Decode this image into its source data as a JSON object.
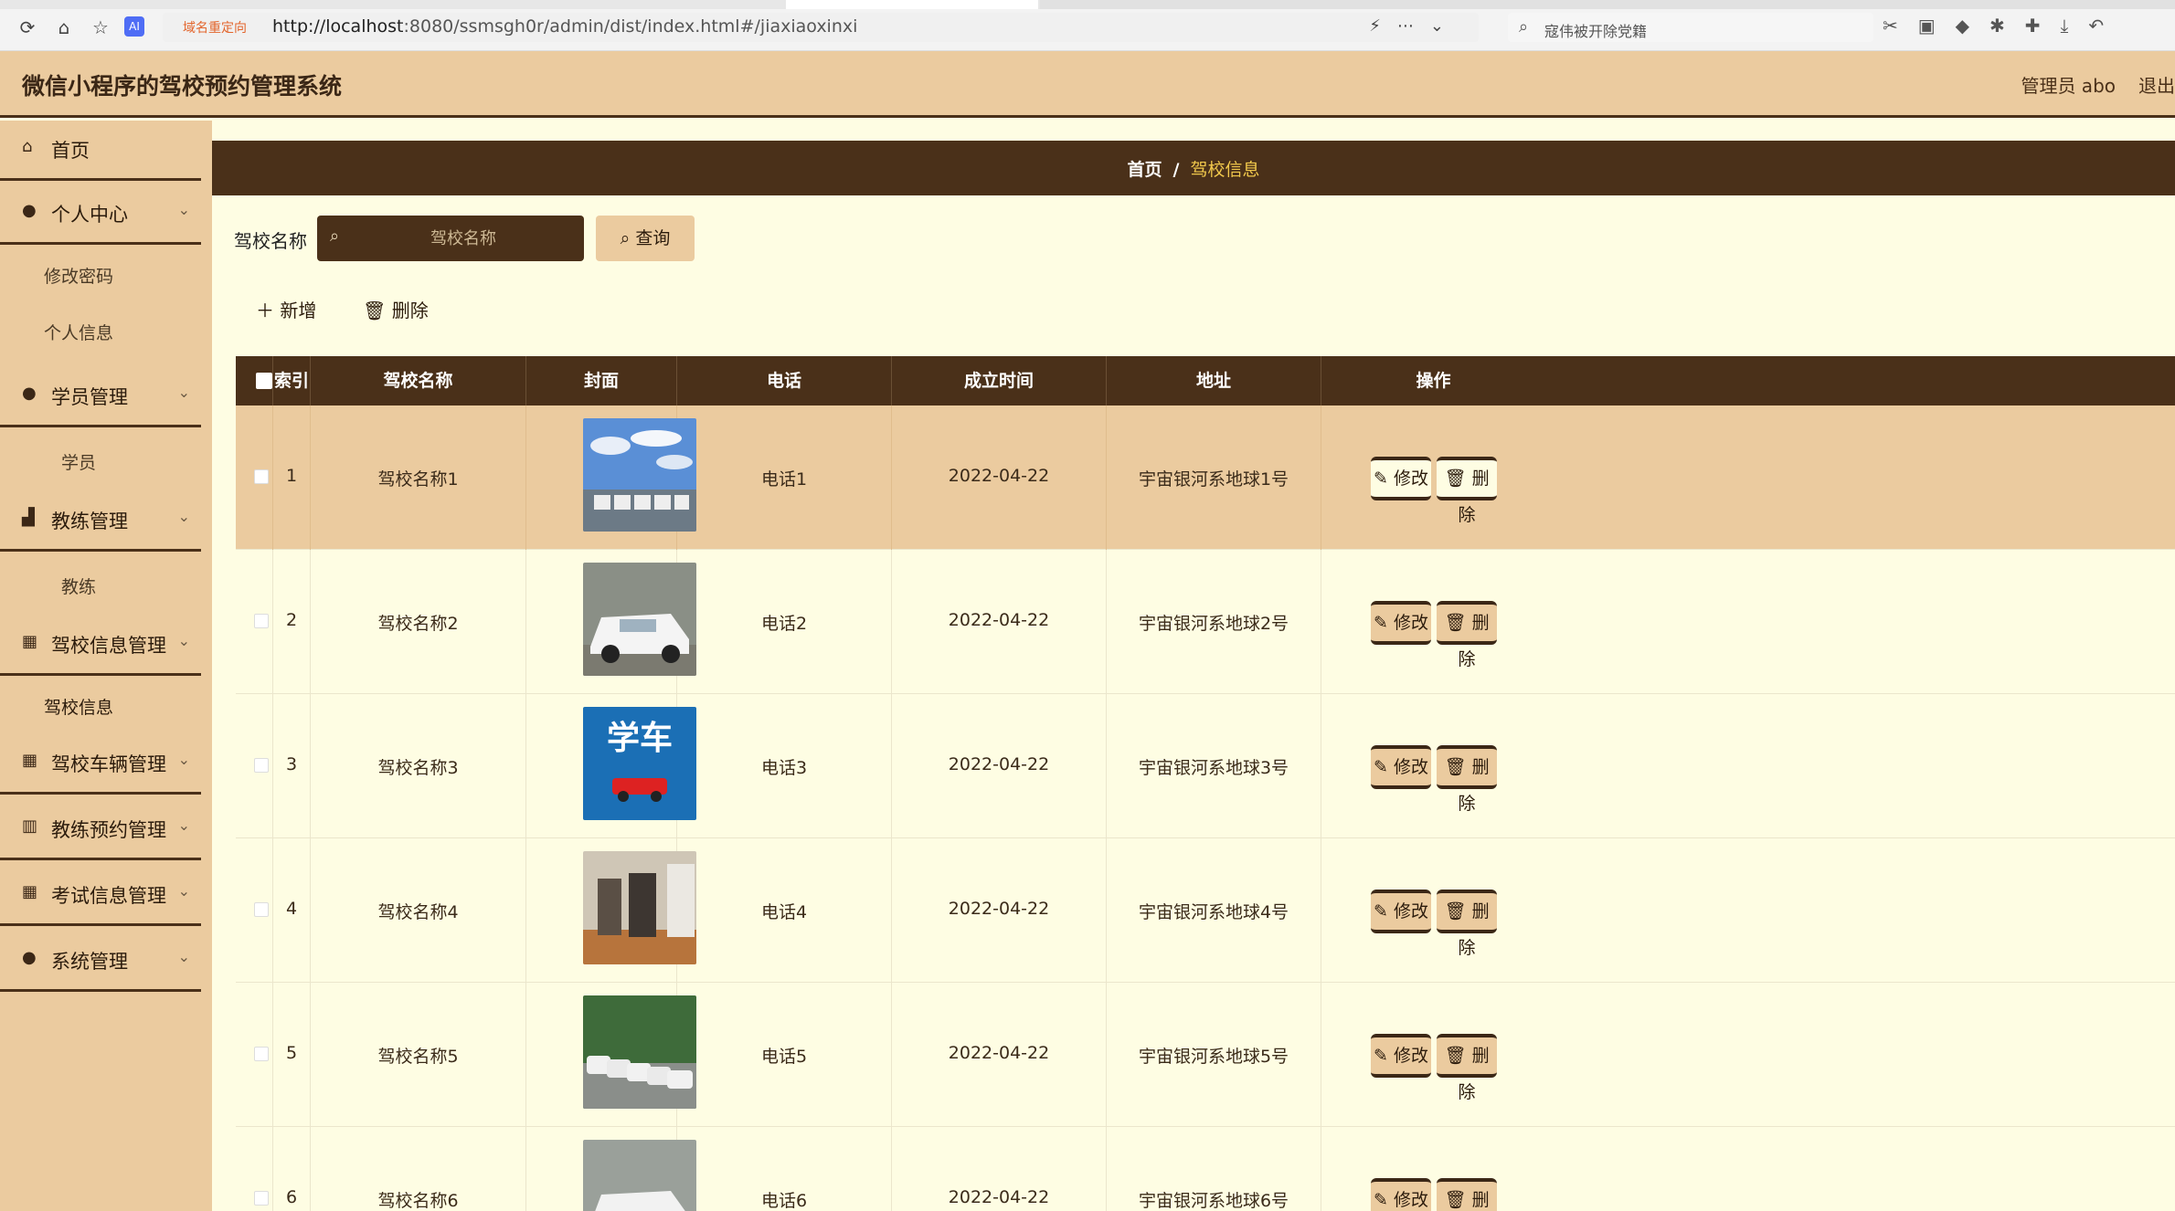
{
  "browser": {
    "url_tag": "域名重定向",
    "url_host": "http://localhost",
    "url_path": ":8080/ssmsgh0r/admin/dist/index.html#/jiaxiaoxinxi",
    "search_text": "寇伟被开除党籍"
  },
  "header": {
    "title": "微信小程序的驾校预约管理系统",
    "admin": "管理员 abo",
    "logout": "退出"
  },
  "sidebar": {
    "home": "首页",
    "personal": "个人中心",
    "change_password": "修改密码",
    "personal_info": "个人信息",
    "student_mgmt": "学员管理",
    "student": "学员",
    "coach_mgmt": "教练管理",
    "coach": "教练",
    "school_info_mgmt": "驾校信息管理",
    "school_info": "驾校信息",
    "vehicle_mgmt": "驾校车辆管理",
    "booking_mgmt": "教练预约管理",
    "exam_mgmt": "考试信息管理",
    "system_mgmt": "系统管理"
  },
  "breadcrumb": {
    "home": "首页",
    "sep": "/",
    "current": "驾校信息"
  },
  "filter": {
    "label": "驾校名称",
    "placeholder": "驾校名称",
    "query": "查询"
  },
  "actions": {
    "add": "新增",
    "delete": "删除",
    "edit": "修改",
    "row_delete": "删除"
  },
  "table": {
    "headers": [
      "索引",
      "驾校名称",
      "封面",
      "电话",
      "成立时间",
      "地址",
      "操作"
    ],
    "rows": [
      {
        "index": "1",
        "name": "驾校名称1",
        "phone": "电话1",
        "date": "2022-04-22",
        "address": "宇宙银河系地球1号"
      },
      {
        "index": "2",
        "name": "驾校名称2",
        "phone": "电话2",
        "date": "2022-04-22",
        "address": "宇宙银河系地球2号"
      },
      {
        "index": "3",
        "name": "驾校名称3",
        "phone": "电话3",
        "date": "2022-04-22",
        "address": "宇宙银河系地球3号"
      },
      {
        "index": "4",
        "name": "驾校名称4",
        "phone": "电话4",
        "date": "2022-04-22",
        "address": "宇宙银河系地球4号"
      },
      {
        "index": "5",
        "name": "驾校名称5",
        "phone": "电话5",
        "date": "2022-04-22",
        "address": "宇宙银河系地球5号"
      },
      {
        "index": "6",
        "name": "驾校名称6",
        "phone": "电话6",
        "date": "2022-04-22",
        "address": "宇宙银河系地球6号"
      }
    ]
  },
  "cover_thumb_text": "学车",
  "colors": {
    "brown": "#4a3019",
    "tan": "#ebcb9f",
    "cream": "#fefde3",
    "crumb_active": "#f2c94c"
  }
}
